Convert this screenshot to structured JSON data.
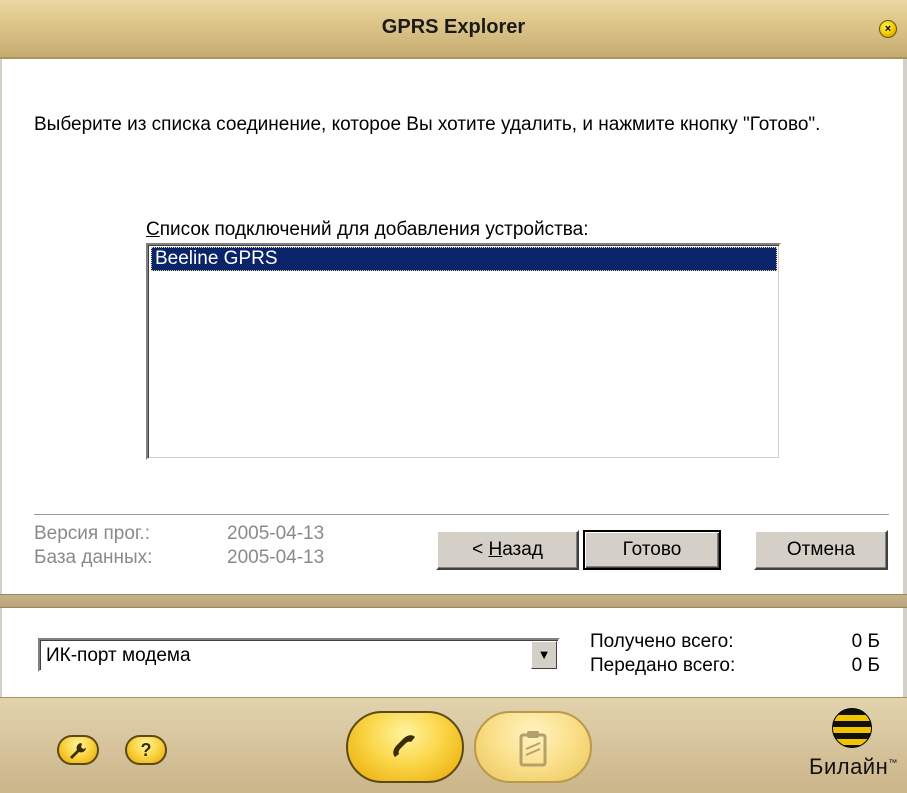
{
  "window": {
    "title": "GPRS Explorer",
    "close_glyph": "×"
  },
  "content": {
    "instruction": "Выберите из списка соединение, которое Вы хотите удалить, и нажмите кнопку \"Готово\".",
    "list_label_first": "С",
    "list_label_rest": "писок подключений для добавления устройства:",
    "connections": [
      {
        "label": "Beeline GPRS",
        "selected": true
      }
    ]
  },
  "info": {
    "version_label": "Версия прог.:",
    "version_value": "2005-04-13",
    "db_label": "База данных:",
    "db_value": "2005-04-13"
  },
  "buttons": {
    "back_prefix": "< ",
    "back_accel": "Н",
    "back_rest": "азад",
    "done": "Готово",
    "cancel": "Отмена"
  },
  "status": {
    "modem_select_value": "ИК-порт модема",
    "received_label": "Получено всего:",
    "received_value": "0 Б",
    "sent_label": "Передано всего:",
    "sent_value": "0 Б"
  },
  "toolbar": {
    "settings_icon": "wrench-icon",
    "help_label": "?",
    "call_icon": "phone-icon",
    "clipboard_icon": "clipboard-icon"
  },
  "brand": {
    "logo_text": "Билайн",
    "logo_tm": "™",
    "accent_color": "#fbd74a"
  }
}
